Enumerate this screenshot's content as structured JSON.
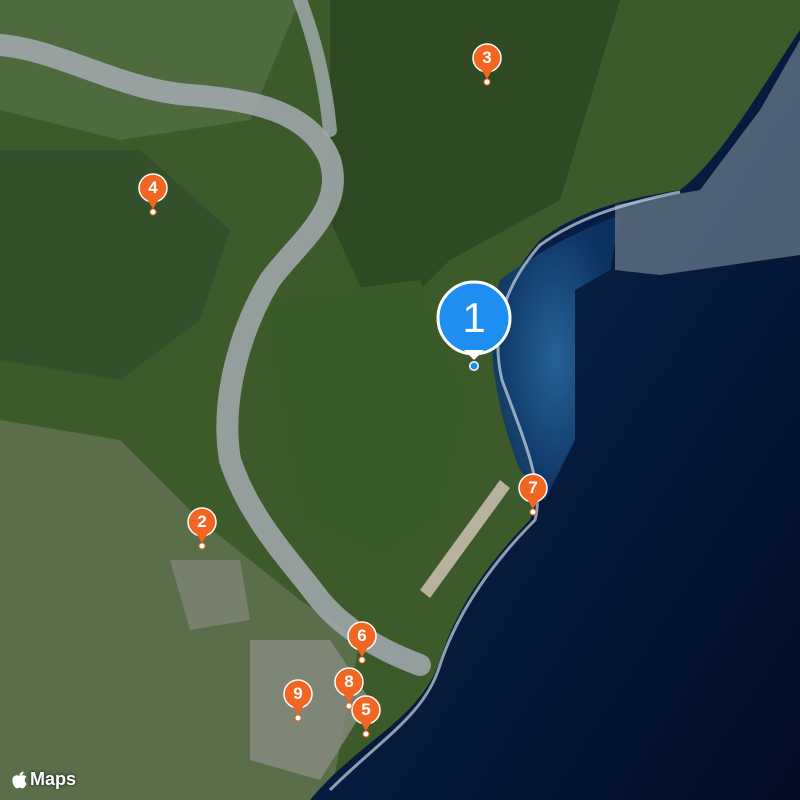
{
  "map": {
    "style": "satellite"
  },
  "colors": {
    "pin_orange": "#f26522",
    "pin_blue": "#2196f3",
    "land": "#3f5a2c",
    "sea_deep": "#04122e",
    "sea_shallow": "#1c4f86",
    "river": "#9fa8b0"
  },
  "markers": [
    {
      "label": "1",
      "style": "selected",
      "color": "#1e8ef0"
    },
    {
      "label": "2",
      "style": "default"
    },
    {
      "label": "3",
      "style": "default"
    },
    {
      "label": "4",
      "style": "default"
    },
    {
      "label": "5",
      "style": "default"
    },
    {
      "label": "6",
      "style": "default"
    },
    {
      "label": "7",
      "style": "default"
    },
    {
      "label": "8",
      "style": "default"
    },
    {
      "label": "9",
      "style": "default"
    }
  ],
  "attribution": {
    "icon": "apple-logo-icon",
    "text": "Maps"
  }
}
